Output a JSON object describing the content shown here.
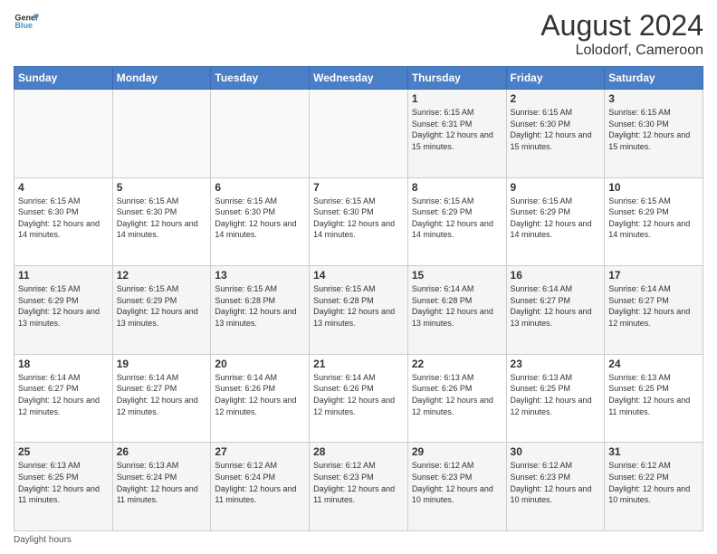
{
  "header": {
    "logo_line1": "General",
    "logo_line2": "Blue",
    "month_year": "August 2024",
    "location": "Lolodorf, Cameroon"
  },
  "weekdays": [
    "Sunday",
    "Monday",
    "Tuesday",
    "Wednesday",
    "Thursday",
    "Friday",
    "Saturday"
  ],
  "weeks": [
    [
      {
        "day": "",
        "info": ""
      },
      {
        "day": "",
        "info": ""
      },
      {
        "day": "",
        "info": ""
      },
      {
        "day": "",
        "info": ""
      },
      {
        "day": "1",
        "info": "Sunrise: 6:15 AM\nSunset: 6:31 PM\nDaylight: 12 hours and 15 minutes."
      },
      {
        "day": "2",
        "info": "Sunrise: 6:15 AM\nSunset: 6:30 PM\nDaylight: 12 hours and 15 minutes."
      },
      {
        "day": "3",
        "info": "Sunrise: 6:15 AM\nSunset: 6:30 PM\nDaylight: 12 hours and 15 minutes."
      }
    ],
    [
      {
        "day": "4",
        "info": "Sunrise: 6:15 AM\nSunset: 6:30 PM\nDaylight: 12 hours and 14 minutes."
      },
      {
        "day": "5",
        "info": "Sunrise: 6:15 AM\nSunset: 6:30 PM\nDaylight: 12 hours and 14 minutes."
      },
      {
        "day": "6",
        "info": "Sunrise: 6:15 AM\nSunset: 6:30 PM\nDaylight: 12 hours and 14 minutes."
      },
      {
        "day": "7",
        "info": "Sunrise: 6:15 AM\nSunset: 6:30 PM\nDaylight: 12 hours and 14 minutes."
      },
      {
        "day": "8",
        "info": "Sunrise: 6:15 AM\nSunset: 6:29 PM\nDaylight: 12 hours and 14 minutes."
      },
      {
        "day": "9",
        "info": "Sunrise: 6:15 AM\nSunset: 6:29 PM\nDaylight: 12 hours and 14 minutes."
      },
      {
        "day": "10",
        "info": "Sunrise: 6:15 AM\nSunset: 6:29 PM\nDaylight: 12 hours and 14 minutes."
      }
    ],
    [
      {
        "day": "11",
        "info": "Sunrise: 6:15 AM\nSunset: 6:29 PM\nDaylight: 12 hours and 13 minutes."
      },
      {
        "day": "12",
        "info": "Sunrise: 6:15 AM\nSunset: 6:29 PM\nDaylight: 12 hours and 13 minutes."
      },
      {
        "day": "13",
        "info": "Sunrise: 6:15 AM\nSunset: 6:28 PM\nDaylight: 12 hours and 13 minutes."
      },
      {
        "day": "14",
        "info": "Sunrise: 6:15 AM\nSunset: 6:28 PM\nDaylight: 12 hours and 13 minutes."
      },
      {
        "day": "15",
        "info": "Sunrise: 6:14 AM\nSunset: 6:28 PM\nDaylight: 12 hours and 13 minutes."
      },
      {
        "day": "16",
        "info": "Sunrise: 6:14 AM\nSunset: 6:27 PM\nDaylight: 12 hours and 13 minutes."
      },
      {
        "day": "17",
        "info": "Sunrise: 6:14 AM\nSunset: 6:27 PM\nDaylight: 12 hours and 12 minutes."
      }
    ],
    [
      {
        "day": "18",
        "info": "Sunrise: 6:14 AM\nSunset: 6:27 PM\nDaylight: 12 hours and 12 minutes."
      },
      {
        "day": "19",
        "info": "Sunrise: 6:14 AM\nSunset: 6:27 PM\nDaylight: 12 hours and 12 minutes."
      },
      {
        "day": "20",
        "info": "Sunrise: 6:14 AM\nSunset: 6:26 PM\nDaylight: 12 hours and 12 minutes."
      },
      {
        "day": "21",
        "info": "Sunrise: 6:14 AM\nSunset: 6:26 PM\nDaylight: 12 hours and 12 minutes."
      },
      {
        "day": "22",
        "info": "Sunrise: 6:13 AM\nSunset: 6:26 PM\nDaylight: 12 hours and 12 minutes."
      },
      {
        "day": "23",
        "info": "Sunrise: 6:13 AM\nSunset: 6:25 PM\nDaylight: 12 hours and 12 minutes."
      },
      {
        "day": "24",
        "info": "Sunrise: 6:13 AM\nSunset: 6:25 PM\nDaylight: 12 hours and 11 minutes."
      }
    ],
    [
      {
        "day": "25",
        "info": "Sunrise: 6:13 AM\nSunset: 6:25 PM\nDaylight: 12 hours and 11 minutes."
      },
      {
        "day": "26",
        "info": "Sunrise: 6:13 AM\nSunset: 6:24 PM\nDaylight: 12 hours and 11 minutes."
      },
      {
        "day": "27",
        "info": "Sunrise: 6:12 AM\nSunset: 6:24 PM\nDaylight: 12 hours and 11 minutes."
      },
      {
        "day": "28",
        "info": "Sunrise: 6:12 AM\nSunset: 6:23 PM\nDaylight: 12 hours and 11 minutes."
      },
      {
        "day": "29",
        "info": "Sunrise: 6:12 AM\nSunset: 6:23 PM\nDaylight: 12 hours and 10 minutes."
      },
      {
        "day": "30",
        "info": "Sunrise: 6:12 AM\nSunset: 6:23 PM\nDaylight: 12 hours and 10 minutes."
      },
      {
        "day": "31",
        "info": "Sunrise: 6:12 AM\nSunset: 6:22 PM\nDaylight: 12 hours and 10 minutes."
      }
    ]
  ],
  "footer": {
    "label": "Daylight hours"
  }
}
